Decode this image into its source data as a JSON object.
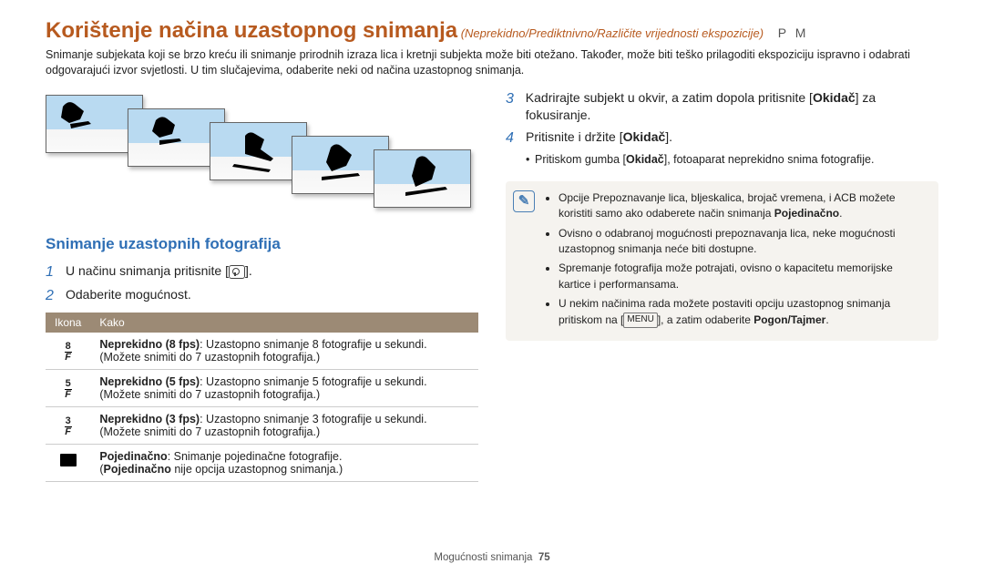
{
  "title": {
    "main": "Korištenje načina uzastopnog snimanja",
    "sub": "(Neprekidno/Prediktnivno/Različite vrijednosti ekspozicije)",
    "modes": "P M"
  },
  "intro": "Snimanje subjekata koji se brzo kreću ili snimanje prirodnih izraza lica i kretnji subjekta može biti otežano. Također, može biti teško prilagoditi ekspoziciju ispravno i odabrati odgovarajući izvor svjetlosti. U tim slučajevima, odaberite neki od načina uzastopnog snimanja.",
  "section_heading": "Snimanje uzastopnih fotografija",
  "left_steps": {
    "s1": "U načinu snimanja pritisnite [",
    "s1b": "].",
    "s2": "Odaberite mogućnost."
  },
  "table": {
    "h_icon": "Ikona",
    "h_how": "Kako",
    "rows": [
      {
        "icon": {
          "top": "8",
          "bot": "F"
        },
        "bold": "Neprekidno (8 fps)",
        "rest": ": Uzastopno snimanje 8 fotografije u sekundi. (Možete snimiti do 7 uzastopnih fotografija.)"
      },
      {
        "icon": {
          "top": "5",
          "bot": "F"
        },
        "bold": "Neprekidno (5 fps)",
        "rest": ": Uzastopno snimanje 5 fotografije u sekundi. (Možete snimiti do 7 uzastopnih fotografija.)"
      },
      {
        "icon": {
          "top": "3",
          "bot": "F"
        },
        "bold": "Neprekidno (3 fps)",
        "rest": ": Uzastopno snimanje 3 fotografije u sekundi. (Možete snimiti do 7 uzastopnih fotografija.)"
      },
      {
        "icon": "single",
        "bold": "Pojedinačno",
        "rest": ": Snimanje pojedinačne fotografije.",
        "extra_bold": "Pojedinačno",
        "extra_rest": " nije opcija uzastopnog snimanja.)"
      }
    ]
  },
  "right_steps": {
    "s3a": "Kadrirajte subjekt u okvir, a zatim dopola pritisnite [",
    "s3bold": "Okidač",
    "s3b": "] za fokusiranje.",
    "s4a": "Pritisnite i držite [",
    "s4bold": "Okidač",
    "s4b": "].",
    "sub_a": "Pritiskom gumba [",
    "sub_bold": "Okidač",
    "sub_b": "], fotoaparat neprekidno snima fotografije."
  },
  "notes": {
    "n1a": "Opcije Prepoznavanje lica, bljeskalica, brojač vremena, i ACB možete koristiti samo ako odaberete način snimanja ",
    "n1bold": "Pojedinačno",
    "n1b": ".",
    "n2": "Ovisno o odabranoj mogućnosti prepoznavanja lica, neke mogućnosti uzastopnog snimanja neće biti dostupne.",
    "n3": "Spremanje fotografija može potrajati, ovisno o kapacitetu memorijske kartice i performansama.",
    "n4a": "U nekim načinima rada možete postaviti opciju uzastopnog snimanja pritiskom na [",
    "n4menu": "MENU",
    "n4b": "], a zatim odaberite ",
    "n4bold": "Pogon/Tajmer",
    "n4c": "."
  },
  "footer": {
    "label": "Mogućnosti snimanja",
    "page": "75"
  }
}
